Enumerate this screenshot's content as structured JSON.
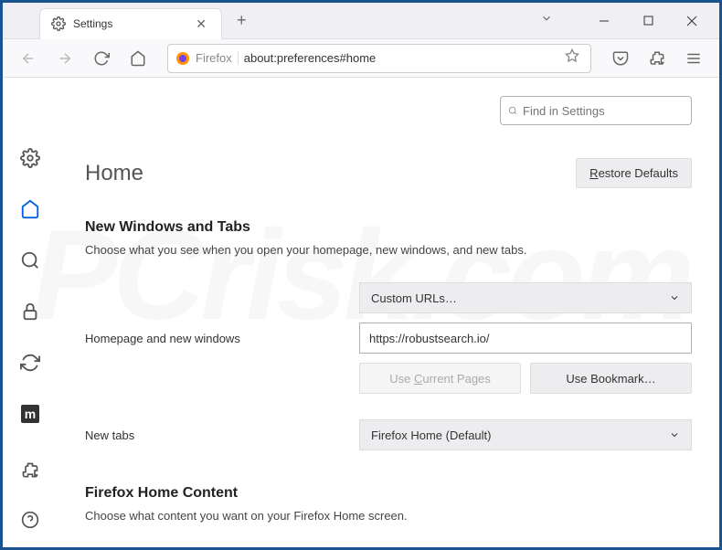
{
  "tab": {
    "title": "Settings"
  },
  "urlbar": {
    "prefix": "Firefox",
    "url": "about:preferences#home"
  },
  "search": {
    "placeholder": "Find in Settings"
  },
  "page": {
    "title": "Home"
  },
  "buttons": {
    "restore": "Restore Defaults",
    "use_current": "Use Current Pages",
    "use_bookmark": "Use Bookmark…"
  },
  "sections": {
    "windows_tabs": {
      "title": "New Windows and Tabs",
      "desc": "Choose what you see when you open your homepage, new windows, and new tabs."
    },
    "home_content": {
      "title": "Firefox Home Content",
      "desc": "Choose what content you want on your Firefox Home screen."
    }
  },
  "form": {
    "homepage_label": "Homepage and new windows",
    "homepage_select": "Custom URLs…",
    "homepage_value": "https://robustsearch.io/",
    "newtabs_label": "New tabs",
    "newtabs_select": "Firefox Home (Default)"
  }
}
